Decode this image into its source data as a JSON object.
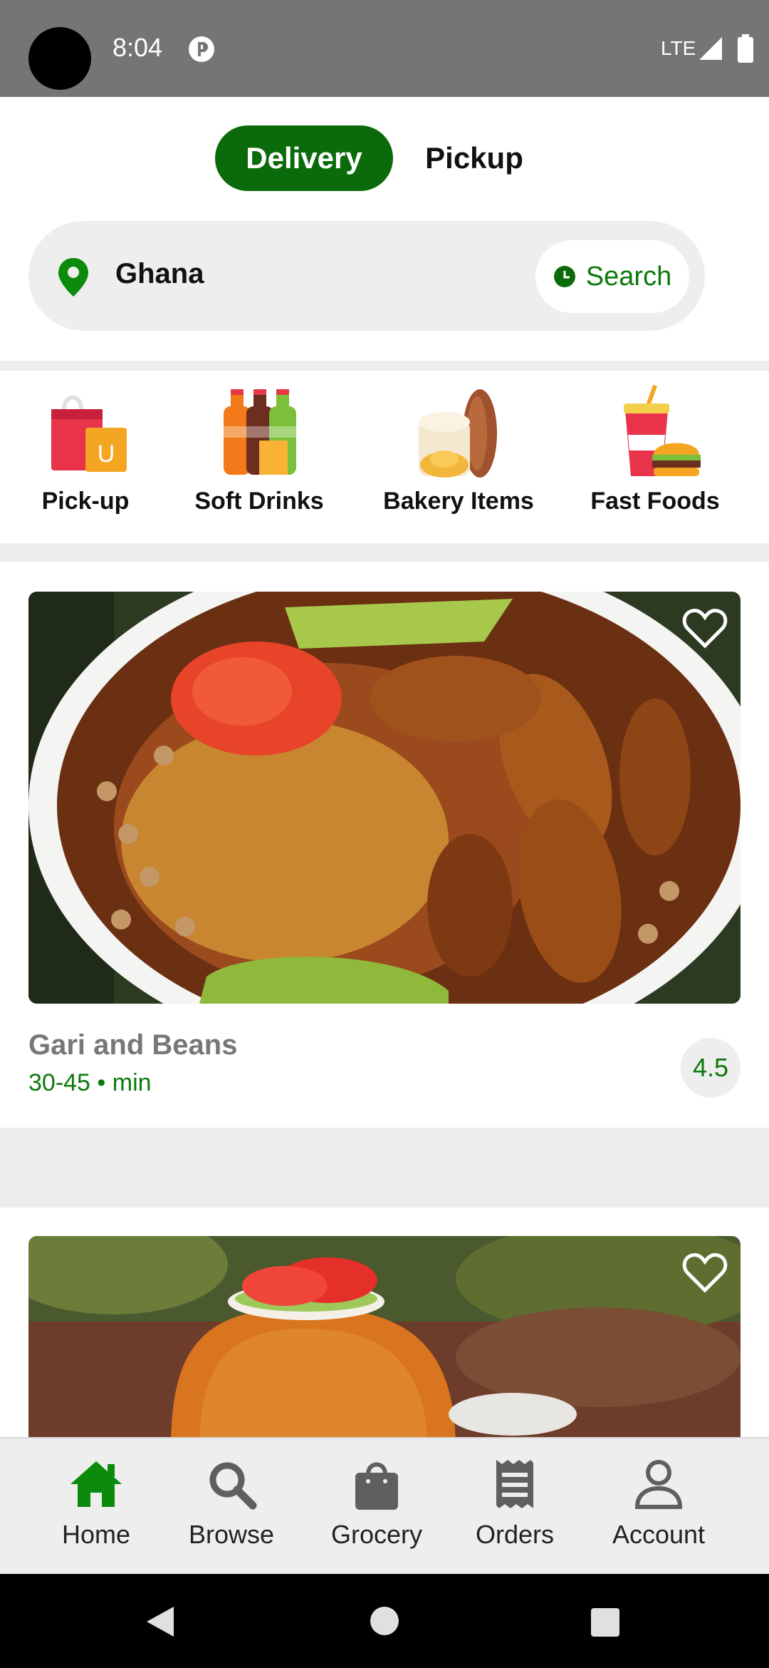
{
  "status_bar": {
    "time": "8:04",
    "network": "LTE",
    "icons": [
      "app-notification-icon",
      "signal-icon",
      "battery-icon"
    ]
  },
  "mode_toggle": {
    "delivery_label": "Delivery",
    "pickup_label": "Pickup",
    "selected": "Delivery"
  },
  "location": {
    "value": "Ghana",
    "search_label": "Search",
    "icons": [
      "location-pin-icon",
      "clock-icon"
    ]
  },
  "categories": [
    {
      "label": "Pick-up",
      "icon": "shopping-bags-icon"
    },
    {
      "label": "Soft Drinks",
      "icon": "soda-bottles-icon"
    },
    {
      "label": "Bakery Items",
      "icon": "bread-icon"
    },
    {
      "label": "Fast Foods",
      "icon": "burger-drink-icon"
    }
  ],
  "cards": [
    {
      "title": "Gari and Beans",
      "meta": "30-45 • min",
      "rating": "4.5",
      "image": "gari-and-beans-photo"
    },
    {
      "image": "jollof-rice-photo"
    }
  ],
  "bottom_nav": {
    "items": [
      {
        "label": "Home",
        "icon": "home-icon",
        "active": true
      },
      {
        "label": "Browse",
        "icon": "search-icon",
        "active": false
      },
      {
        "label": "Grocery",
        "icon": "shopping-bag-icon",
        "active": false
      },
      {
        "label": "Orders",
        "icon": "receipt-icon",
        "active": false
      },
      {
        "label": "Account",
        "icon": "person-icon",
        "active": false
      }
    ]
  },
  "colors": {
    "accent": "#0b6b0b",
    "accent_text": "#0b7a0b",
    "surface": "#eeeeee",
    "status_bar": "#757575"
  }
}
